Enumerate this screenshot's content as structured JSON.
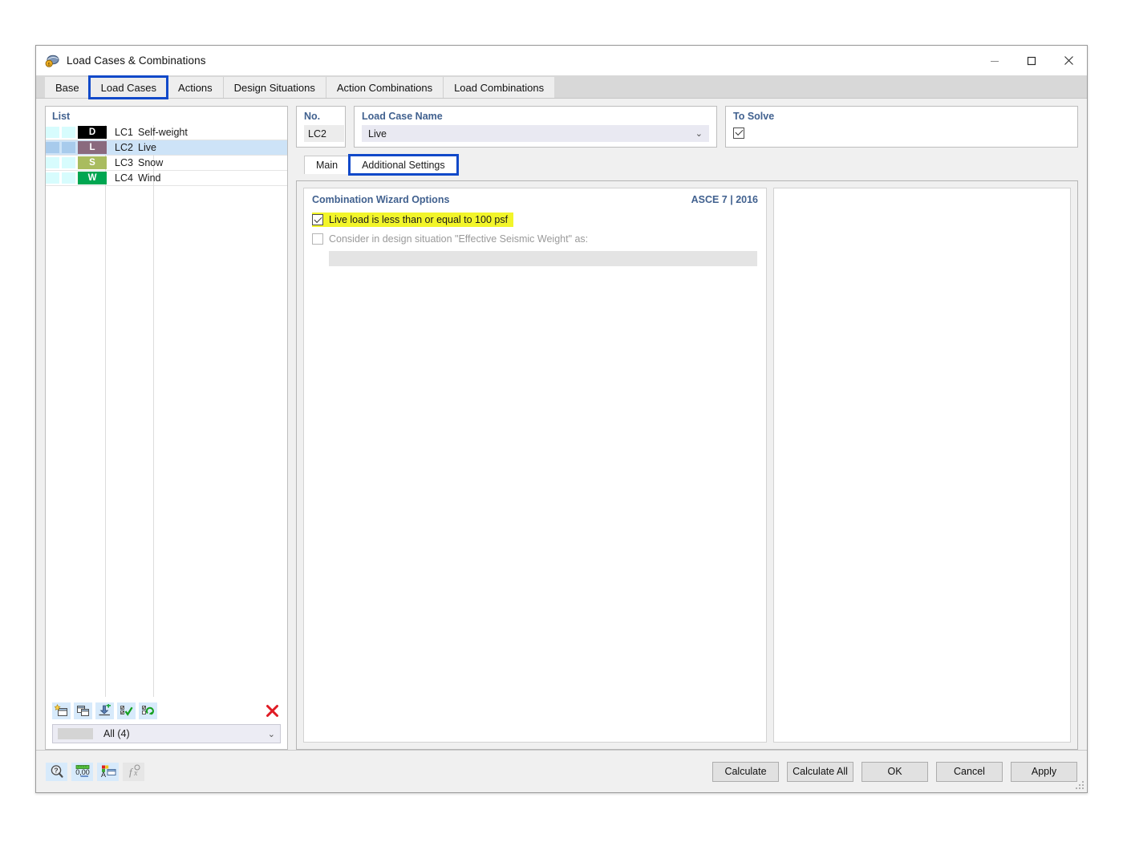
{
  "window": {
    "title": "Load Cases & Combinations",
    "icon": "load-cases-app-icon",
    "controls": {
      "minimize": "—",
      "maximize": "☐",
      "close": "✕"
    }
  },
  "tabs": [
    {
      "label": "Base",
      "active": false,
      "highlighted": false
    },
    {
      "label": "Load Cases",
      "active": true,
      "highlighted": true
    },
    {
      "label": "Actions",
      "active": false,
      "highlighted": false
    },
    {
      "label": "Design Situations",
      "active": false,
      "highlighted": false
    },
    {
      "label": "Action Combinations",
      "active": false,
      "highlighted": false
    },
    {
      "label": "Load Combinations",
      "active": false,
      "highlighted": false
    }
  ],
  "list": {
    "header": "List",
    "rows": [
      {
        "badge": "D",
        "badge_color": "#000000",
        "no": "LC1",
        "name": "Self-weight",
        "selected": false
      },
      {
        "badge": "L",
        "badge_color": "#8a6a7e",
        "no": "LC2",
        "name": "Live",
        "selected": true
      },
      {
        "badge": "S",
        "badge_color": "#a9bc5f",
        "no": "LC3",
        "name": "Snow",
        "selected": false
      },
      {
        "badge": "W",
        "badge_color": "#00a651",
        "no": "LC4",
        "name": "Wind",
        "selected": false
      }
    ],
    "toolbar": [
      {
        "name": "new-load-case-button",
        "icon": "new-window-star-icon"
      },
      {
        "name": "copy-load-case-button",
        "icon": "copy-windows-icon"
      },
      {
        "name": "import-load-case-button",
        "icon": "import-down-arrow-icon"
      },
      {
        "name": "select-all-button",
        "icon": "checklist-green-check-icon"
      },
      {
        "name": "invert-selection-button",
        "icon": "checklist-refresh-icon"
      },
      {
        "name": "delete-load-case-button",
        "icon": "red-x-delete-icon"
      }
    ],
    "filter": {
      "label": "All (4)",
      "arrow": "⌄"
    }
  },
  "fields": {
    "no": {
      "label": "No.",
      "value": "LC2"
    },
    "load_case_name": {
      "label": "Load Case Name",
      "value": "Live",
      "arrow": "⌄"
    },
    "to_solve": {
      "label": "To Solve",
      "checked": true
    }
  },
  "subtabs": [
    {
      "label": "Main",
      "active": false,
      "highlighted": false
    },
    {
      "label": "Additional Settings",
      "active": true,
      "highlighted": true
    }
  ],
  "wizard": {
    "title": "Combination Wizard Options",
    "standard": "ASCE 7 | 2016",
    "options": [
      {
        "label": "Live load is less than or equal to 100 psf",
        "checked": true,
        "highlighted": true,
        "disabled": false
      },
      {
        "label": "Consider in design situation \"Effective Seismic Weight\" as:",
        "checked": false,
        "highlighted": false,
        "disabled": true
      }
    ],
    "seismic_field_value": ""
  },
  "footer": {
    "tools": [
      {
        "name": "info-magnifier-button",
        "icon": "magnifier-question-icon",
        "enabled": true
      },
      {
        "name": "units-button",
        "icon": "ruler-decimals-icon",
        "enabled": true
      },
      {
        "name": "display-properties-button",
        "icon": "color-palette-window-icon",
        "enabled": true
      },
      {
        "name": "formula-button",
        "icon": "function-fx-icon",
        "enabled": false
      }
    ],
    "buttons": [
      {
        "label": "Calculate",
        "name": "calculate-button"
      },
      {
        "label": "Calculate All",
        "name": "calculate-all-button"
      },
      {
        "label": "OK",
        "name": "ok-button"
      },
      {
        "label": "Cancel",
        "name": "cancel-button"
      },
      {
        "label": "Apply",
        "name": "apply-button"
      }
    ]
  }
}
